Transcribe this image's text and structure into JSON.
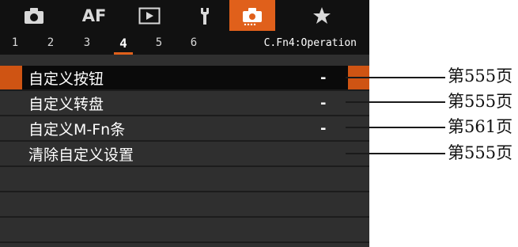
{
  "tabs": [
    {
      "icon": "camera-icon"
    },
    {
      "label": "AF"
    },
    {
      "icon": "playback-icon"
    },
    {
      "icon": "wrench-icon"
    },
    {
      "icon": "custom-functions-icon",
      "active": true
    },
    {
      "icon": "star-icon"
    }
  ],
  "subtabs": [
    "1",
    "2",
    "3",
    "4",
    "5",
    "6"
  ],
  "active_subtab": "4",
  "section_title": "C.Fn4:Operation",
  "menu_items": [
    {
      "label": "自定义按钮",
      "value": "-",
      "selected": true
    },
    {
      "label": "自定义转盘",
      "value": "-"
    },
    {
      "label": "自定义M-Fn条",
      "value": "-"
    },
    {
      "label": "清除自定义设置",
      "value": ""
    }
  ],
  "callouts": [
    "第555页",
    "第555页",
    "第561页",
    "第555页"
  ],
  "colors": {
    "accent": "#e0601b",
    "menu_bg": "#2f2f2f",
    "tab_bg": "#111111"
  }
}
